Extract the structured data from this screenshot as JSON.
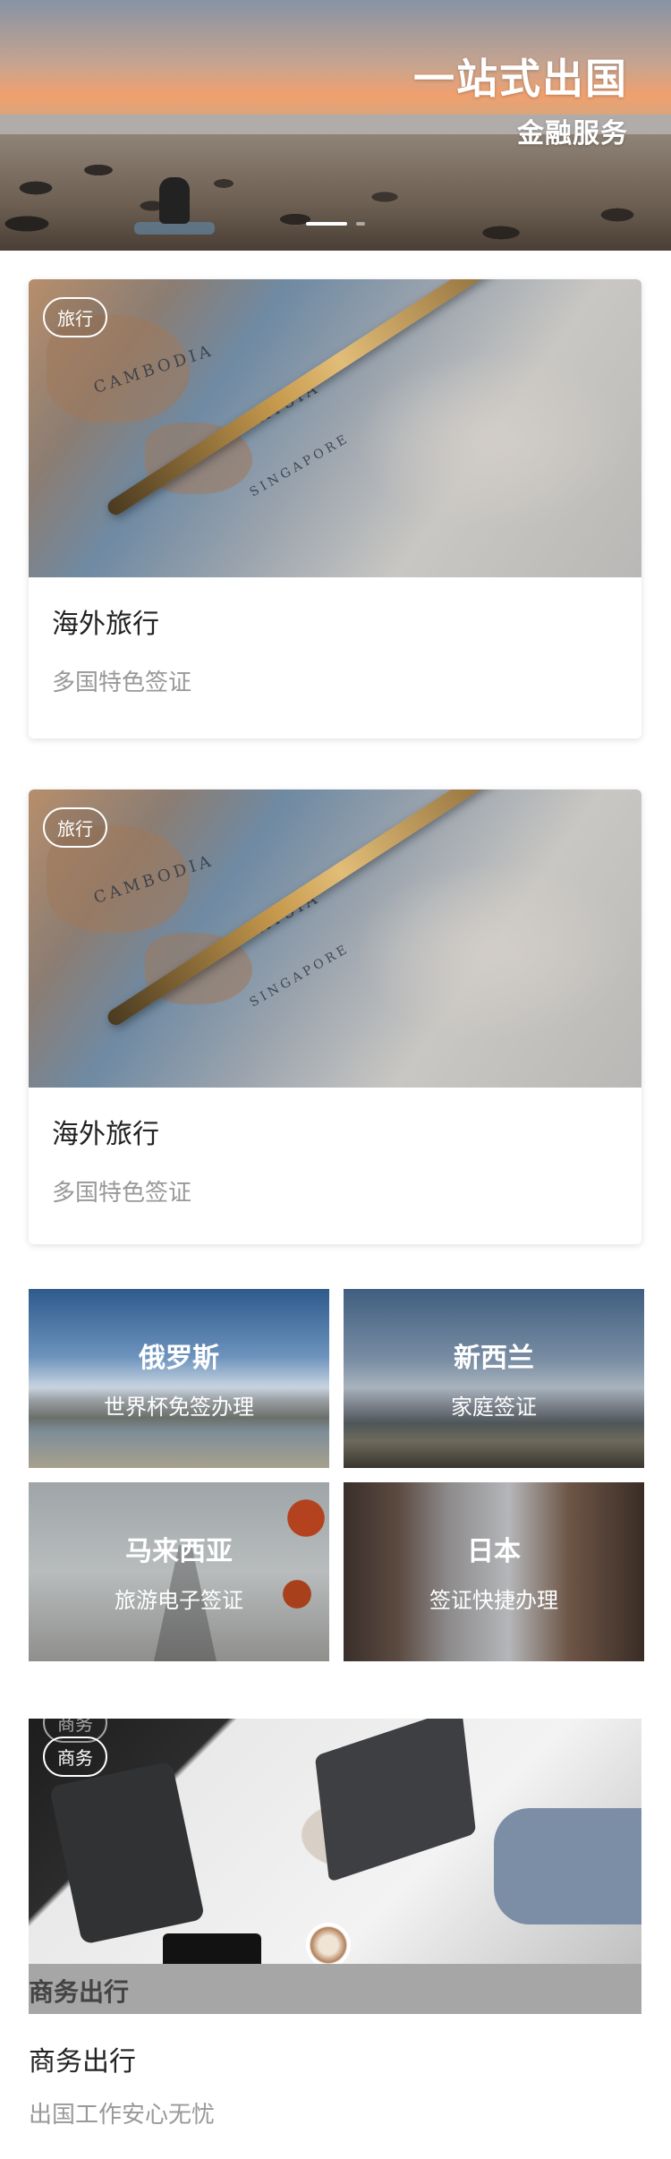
{
  "banner": {
    "title": "一站式出国",
    "subtitle": "金融服务",
    "indicator_count": 2
  },
  "feature_cards": [
    {
      "tag": "旅行",
      "title": "海外旅行",
      "desc": "多国特色签证"
    },
    {
      "tag": "旅行",
      "title": "海外旅行",
      "desc": "多国特色签证"
    }
  ],
  "destinations": [
    {
      "name": "俄罗斯",
      "desc": "世界杯免签办理"
    },
    {
      "name": "新西兰",
      "desc": "家庭签证"
    },
    {
      "name": "马来西亚",
      "desc": "旅游电子签证"
    },
    {
      "name": "日本",
      "desc": "签证快捷办理"
    }
  ],
  "business": {
    "tag": "商务",
    "overlay_title": "商务出行",
    "title": "商务出行",
    "desc": "出国工作安心无忧"
  }
}
